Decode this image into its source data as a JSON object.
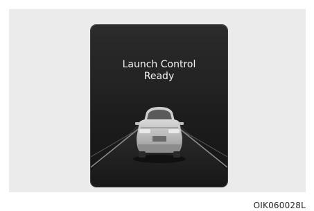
{
  "display": {
    "message_line1": "Launch Control",
    "message_line2": "Ready",
    "graphic_icon": "car-rear-icon"
  },
  "figure_code": "OIK060028L",
  "colors": {
    "screen_background": "#1c1c1c",
    "text": "#f4f4f4",
    "frame": "#ebebeb"
  }
}
